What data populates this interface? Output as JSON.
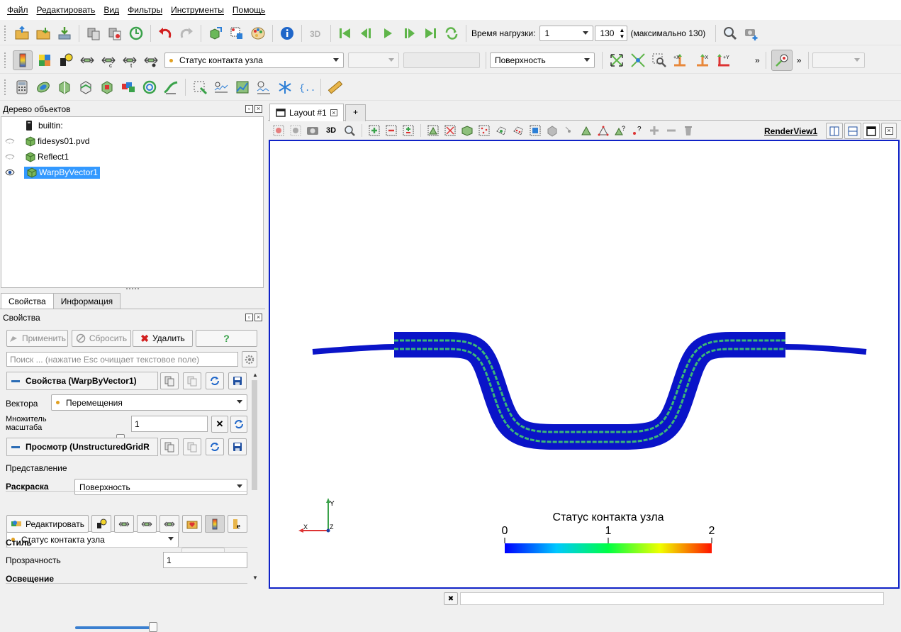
{
  "menu": [
    "Файл",
    "Редактировать",
    "Вид",
    "Фильтры",
    "Инструменты",
    "Помощь"
  ],
  "toolbar1": {
    "time_label": "Время нагрузки:",
    "time_value": "1",
    "step_value": "130",
    "max_label": "(максимально 130)"
  },
  "toolbar2": {
    "color_by": "Статус контакта узла",
    "representation": "Поверхность",
    "more": "»"
  },
  "pipeline": {
    "title": "Дерево объектов",
    "items": [
      {
        "label": "builtin:"
      },
      {
        "label": "fidesys01.pvd"
      },
      {
        "label": "Reflect1"
      },
      {
        "label": "WarpByVector1"
      }
    ]
  },
  "props": {
    "tabs": [
      "Свойства",
      "Информация"
    ],
    "panel_title": "Свойства",
    "apply": "Применить",
    "reset": "Сбросить",
    "delete": "Удалить",
    "help": "?",
    "search_placeholder": "Поиск ... (нажатие Esc очищает текстовое поле)",
    "section_props": "Свойства (WarpByVector1)",
    "vectors_label": "Вектора",
    "vectors_value": "Перемещения",
    "scale_label_1": "Множитель",
    "scale_label_2": "масштаба",
    "scale_value": "1",
    "scale_fraction": 1.0,
    "section_view": "Просмотр (UnstructuredGridR",
    "repr_label": "Представление",
    "repr_value": "Поверхность",
    "coloring_label": "Раскраска",
    "coloring_value": "Статус контакта узла",
    "edit_button": "Редактировать",
    "style_label": "Стиль",
    "opacity_label": "Прозрачность",
    "opacity_value": "1",
    "opacity_fraction": 1.0,
    "lighting_label": "Освещение"
  },
  "view": {
    "layout_tab": "Layout #1",
    "add_tab": "+",
    "btn_3d": "3D",
    "render_view_name": "RenderView1",
    "colorbar_title": "Статус контакта узла",
    "colorbar_ticks": [
      "0",
      "1",
      "2"
    ],
    "axis_x": "X",
    "axis_y": "Y",
    "axis_z": "Z"
  },
  "colors": {
    "accent": "#3399ff",
    "render_border": "#0f22c7",
    "mesh_blue": "#0a14c8",
    "contact_green": "#3cb878"
  }
}
